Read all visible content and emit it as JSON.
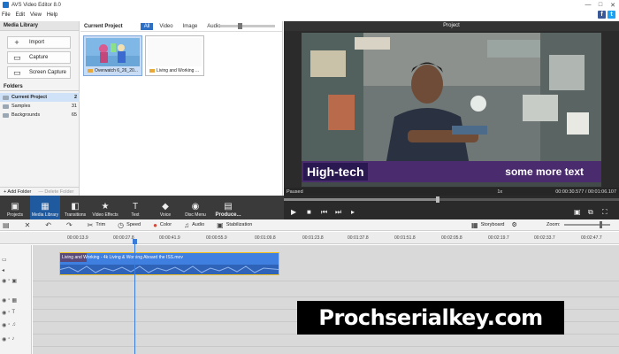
{
  "window": {
    "title": "AVS Video Editor 8.0",
    "buttons": [
      "—",
      "□",
      "✕"
    ]
  },
  "menu": [
    "File",
    "Edit",
    "View",
    "Help"
  ],
  "social": {
    "facebook": "f",
    "twitter": "t"
  },
  "media_library": {
    "title": "Media Library",
    "buttons": [
      {
        "label": "Import",
        "icon": "plus-icon",
        "glyph": "+"
      },
      {
        "label": "Capture",
        "icon": "camera-icon",
        "glyph": "▭"
      },
      {
        "label": "Screen Capture",
        "icon": "monitor-icon",
        "glyph": "▭"
      }
    ],
    "folders_title": "Folders",
    "folders": [
      {
        "name": "Current Project",
        "count": "2",
        "selected": true
      },
      {
        "name": "Samples",
        "count": "31",
        "selected": false
      },
      {
        "name": "Backgrounds",
        "count": "65",
        "selected": false
      }
    ],
    "add_folder": "+ Add Folder",
    "delete_folder": "— Delete Folder"
  },
  "media_area": {
    "title": "Current Project",
    "tabs": [
      "All",
      "Video",
      "Image",
      "Audio"
    ],
    "active_tab": "All",
    "items": [
      {
        "label": "Overwatch 6_26_20...",
        "selected": true
      },
      {
        "label": "Living and Working ...",
        "selected": false
      }
    ]
  },
  "preview": {
    "title": "Project",
    "state": "Paused",
    "speed": "1x",
    "timecode": "00:00:30.577 / 00:01:06.107",
    "caption_left": "High-tech",
    "caption_right": "some more text",
    "progress": 0.46
  },
  "main_tools": [
    {
      "label": "Projects",
      "glyph": "🎬",
      "icon": "projects-icon"
    },
    {
      "label": "Media Library",
      "glyph": "▦",
      "icon": "media-library-icon",
      "active": true
    },
    {
      "label": "Transitions",
      "glyph": "◧",
      "icon": "transitions-icon"
    },
    {
      "label": "Video Effects",
      "glyph": "★",
      "icon": "video-effects-icon"
    },
    {
      "label": "Text",
      "glyph": "T",
      "icon": "text-icon"
    },
    {
      "label": "Voice",
      "glyph": "🎤",
      "icon": "voice-icon"
    },
    {
      "label": "Disc Menu",
      "glyph": "◉",
      "icon": "disc-menu-icon"
    },
    {
      "label": "Produce...",
      "glyph": "🎞",
      "icon": "produce-icon"
    }
  ],
  "timeline_tools": {
    "items": [
      {
        "label": "Trim",
        "glyph": "✂",
        "icon": "trim-icon"
      },
      {
        "label": "Speed",
        "glyph": "◷",
        "icon": "speed-icon"
      },
      {
        "label": "Color",
        "glyph": "●",
        "icon": "color-icon"
      },
      {
        "label": "Audio",
        "glyph": "♫",
        "icon": "audio-icon"
      },
      {
        "label": "Stabilization",
        "glyph": "▣",
        "icon": "stabilization-icon"
      }
    ],
    "storyboard": "Storyboard",
    "zoom": "Zoom:"
  },
  "ruler_ticks": [
    "00:00:13.9",
    "00:00:27.8",
    "00:00:41.9",
    "00:00:55.9",
    "00:01:09.8",
    "00:01:23.8",
    "00:01:37.8",
    "00:01:51.8",
    "00:02:05.8",
    "00:02:19.7",
    "00:02:33.7",
    "00:02:47.7"
  ],
  "clip": {
    "label": "Living and Working - 4k Living & Working Aboard the ISS.mov"
  },
  "watermark": "Prochserialkey.com",
  "colors": {
    "accent": "#2e6fc4",
    "clip": "#3f7fe0",
    "toolbar": "#3a3a3a",
    "watermark_bg": "#000000"
  }
}
